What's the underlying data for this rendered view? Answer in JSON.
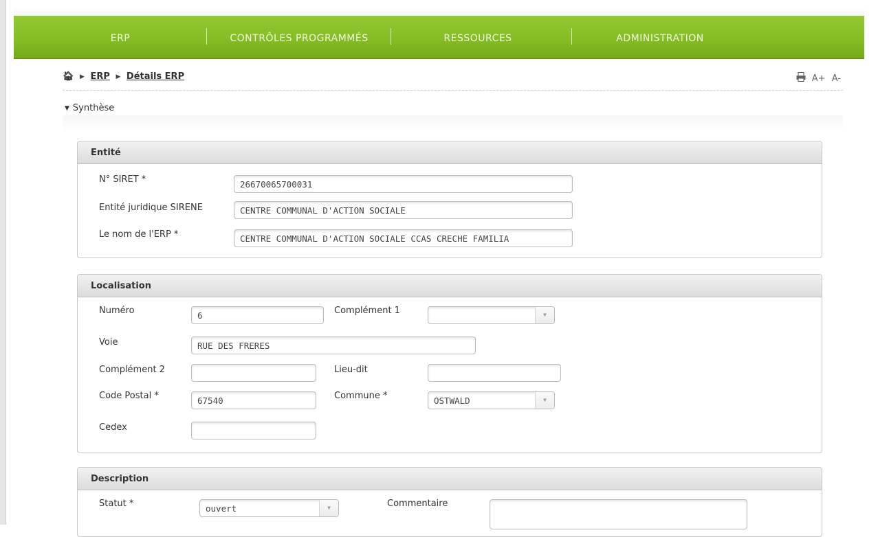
{
  "nav": {
    "items": [
      "ERP",
      "CONTRÔLES PROGRAMMÉS",
      "RESSOURCES",
      "ADMINISTRATION"
    ]
  },
  "breadcrumb": {
    "home_icon": "home-icon",
    "items": [
      "ERP",
      "Détails ERP"
    ]
  },
  "tools": {
    "print_icon": "printer-icon",
    "font_increase": "A+",
    "font_decrease": "A-"
  },
  "synthese": {
    "label": "Synthèse"
  },
  "entite": {
    "title": "Entité",
    "siret_label": "N° SIRET *",
    "siret_value": "26670065700031",
    "juridique_label": "Entité juridique SIRENE",
    "juridique_value": "CENTRE COMMUNAL D'ACTION SOCIALE",
    "nom_label": "Le nom de l'ERP *",
    "nom_value": "CENTRE COMMUNAL D'ACTION SOCIALE CCAS CRECHE FAMILIA"
  },
  "localisation": {
    "title": "Localisation",
    "numero_label": "Numéro",
    "numero_value": "6",
    "complement1_label": "Complément 1",
    "complement1_value": "",
    "voie_label": "Voie",
    "voie_value": "RUE DES FRERES",
    "complement2_label": "Complément 2",
    "complement2_value": "",
    "lieudit_label": "Lieu-dit",
    "lieudit_value": "",
    "cp_label": "Code Postal *",
    "cp_value": "67540",
    "commune_label": "Commune *",
    "commune_value": "OSTWALD",
    "cedex_label": "Cedex",
    "cedex_value": ""
  },
  "description": {
    "title": "Description",
    "statut_label": "Statut *",
    "statut_value": "ouvert",
    "commentaire_label": "Commentaire",
    "commentaire_value": ""
  },
  "colors": {
    "nav_green": "#86bd25",
    "panel_header": "#dcdcdc"
  }
}
